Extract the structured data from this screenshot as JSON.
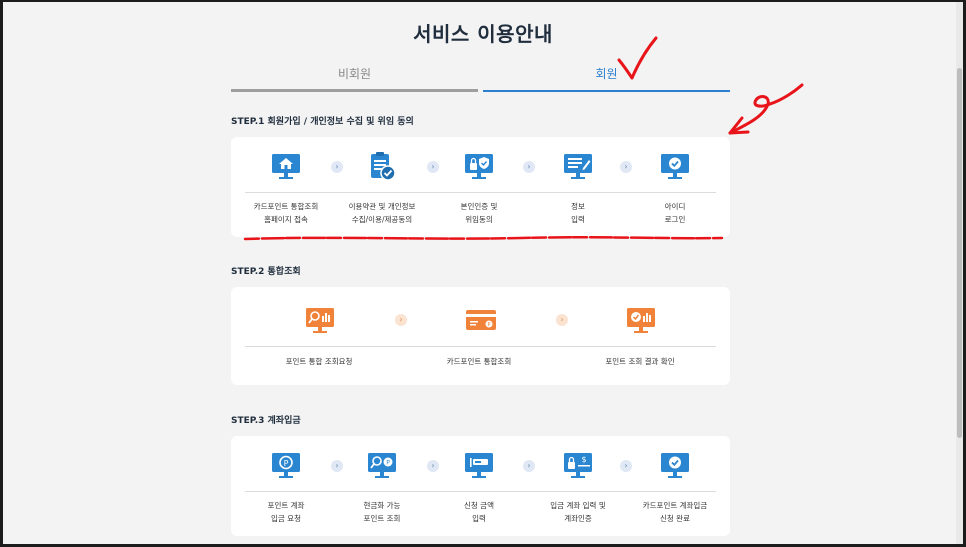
{
  "page": {
    "title": "서비스 이용안내"
  },
  "tabs": [
    {
      "label": "비회원",
      "active": false
    },
    {
      "label": "회원",
      "active": true
    }
  ],
  "steps": [
    {
      "label": "STEP.1 회원가입 / 개인정보 수집 및 위임 동의",
      "items": [
        {
          "icon": "monitor-home-icon",
          "line1": "카드포인트 통합조회",
          "line2": "홈페이지 접속"
        },
        {
          "icon": "clipboard-check-icon",
          "line1": "이용약관 및 개인정보",
          "line2": "수집/이용/제공동의"
        },
        {
          "icon": "monitor-lock-shield-icon",
          "line1": "본인인증 및",
          "line2": "위임동의"
        },
        {
          "icon": "monitor-document-pen-icon",
          "line1": "정보",
          "line2": "입력"
        },
        {
          "icon": "monitor-check-icon",
          "line1": "아이디",
          "line2": "로그인"
        }
      ]
    },
    {
      "label": "STEP.2 통합조회",
      "items": [
        {
          "icon": "monitor-search-chart-icon",
          "line1": "포인트 통합 조회요청"
        },
        {
          "icon": "credit-card-icon",
          "line1": "카드포인트 통합조회"
        },
        {
          "icon": "monitor-check-chart-icon",
          "line1": "포인트 조회 결과 확인"
        }
      ]
    },
    {
      "label": "STEP.3 계좌입금",
      "items": [
        {
          "icon": "monitor-point-icon",
          "line1": "포인트 계좌",
          "line2": "입금 요청"
        },
        {
          "icon": "monitor-search-point-icon",
          "line1": "현금화 가능",
          "line2": "포인트 조회"
        },
        {
          "icon": "monitor-amount-icon",
          "line1": "신청 금액",
          "line2": "입력"
        },
        {
          "icon": "monitor-lock-dollar-icon",
          "line1": "입금 계좌 입력 및",
          "line2": "계좌인증"
        },
        {
          "icon": "monitor-check-icon",
          "line1": "카드포인트 계좌입금",
          "line2": "신청 완료"
        }
      ]
    }
  ],
  "colors": {
    "blue": "#2a86d1",
    "orange": "#f0823a",
    "accent": "#2a7fd0",
    "annotation": "#e8141a"
  },
  "arrow_glyph": "›"
}
